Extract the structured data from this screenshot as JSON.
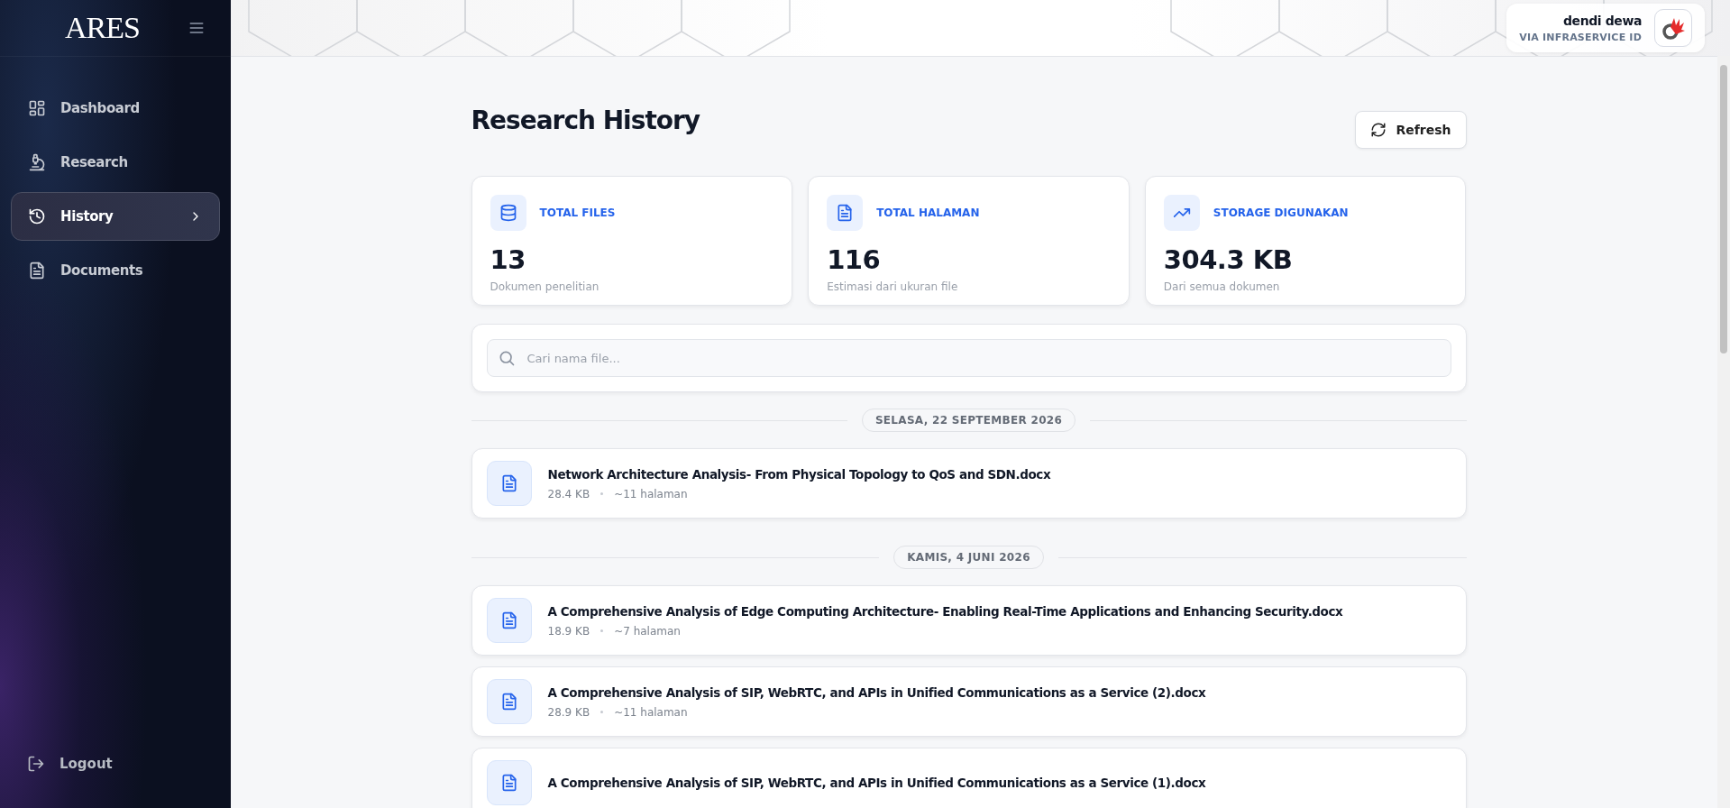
{
  "sidebar": {
    "logo": "ARES",
    "items": [
      {
        "label": "Dashboard",
        "selected": false
      },
      {
        "label": "Research",
        "selected": false
      },
      {
        "label": "History",
        "selected": true
      },
      {
        "label": "Documents",
        "selected": false
      }
    ],
    "logout": "Logout"
  },
  "user": {
    "name": "dendi dewa",
    "via": "VIA INFRASERVICE ID"
  },
  "page": {
    "title": "Research History",
    "refresh": "Refresh"
  },
  "stats": [
    {
      "label": "TOTAL FILES",
      "value": "13",
      "caption": "Dokumen penelitian"
    },
    {
      "label": "TOTAL HALAMAN",
      "value": "116",
      "caption": "Estimasi dari ukuran file"
    },
    {
      "label": "STORAGE DIGUNAKAN",
      "value": "304.3 KB",
      "caption": "Dari semua dokumen"
    }
  ],
  "search": {
    "placeholder": "Cari nama file..."
  },
  "groups": [
    {
      "date": "SELASA, 22 SEPTEMBER 2026",
      "files": [
        {
          "name": "Network Architecture Analysis- From Physical Topology to QoS and SDN.docx",
          "size": "28.4 KB",
          "pages": "~11 halaman"
        }
      ]
    },
    {
      "date": "KAMIS, 4 JUNI 2026",
      "files": [
        {
          "name": "A Comprehensive Analysis of Edge Computing Architecture- Enabling Real-Time Applications and Enhancing Security.docx",
          "size": "18.9 KB",
          "pages": "~7 halaman"
        },
        {
          "name": "A Comprehensive Analysis of SIP, WebRTC, and APIs in Unified Communications as a Service (2).docx",
          "size": "28.9 KB",
          "pages": "~11 halaman"
        },
        {
          "name": "A Comprehensive Analysis of SIP, WebRTC, and APIs in Unified Communications as a Service (1).docx"
        }
      ]
    }
  ]
}
